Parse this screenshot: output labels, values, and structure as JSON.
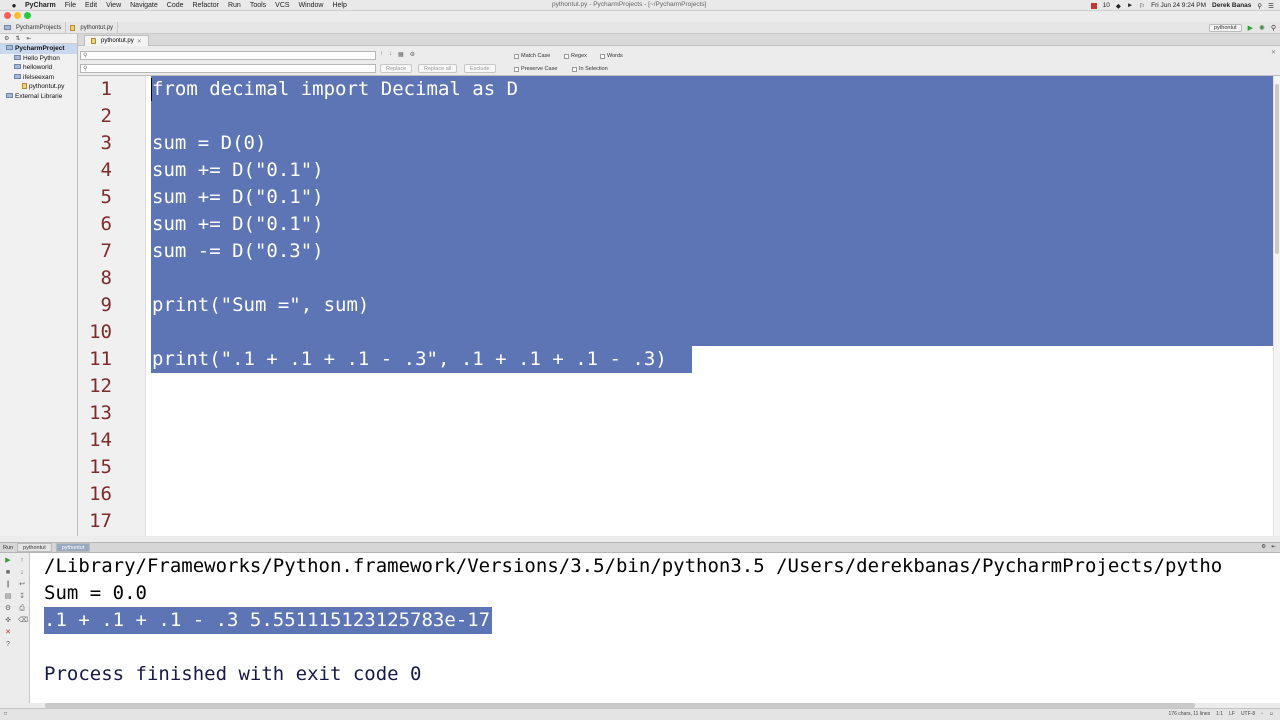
{
  "menubar": {
    "app": "PyCharm",
    "items": [
      "File",
      "Edit",
      "View",
      "Navigate",
      "Code",
      "Refactor",
      "Run",
      "Tools",
      "VCS",
      "Window",
      "Help"
    ],
    "window_title": "pythontut.py - PycharmProjects - [~/PycharmProjects]",
    "battery": "10",
    "datetime": "Fri Jun 24  9:24 PM",
    "user": "Derek Banas"
  },
  "navbar": {
    "crumbs": [
      "PycharmProjects",
      "pythontut.py"
    ],
    "run_config": "pythontut"
  },
  "project": {
    "root": "PycharmProject",
    "items": [
      "Hello Python",
      "helloworld",
      "ifelseexam",
      "pythontut.py"
    ],
    "libraries": "External Librarie"
  },
  "editor": {
    "tab": "pythontut.py",
    "lines": [
      "from decimal import Decimal as D",
      "",
      "sum = D(0)",
      "sum += D(\"0.1\")",
      "sum += D(\"0.1\")",
      "sum += D(\"0.1\")",
      "sum -= D(\"0.3\")",
      "",
      "print(\"Sum =\", sum)",
      "",
      "print(\".1 + .1 + .1 - .3\", .1 + .1 + .1 - .3)",
      "",
      "",
      "",
      "",
      "",
      ""
    ],
    "line_numbers": [
      "1",
      "2",
      "3",
      "4",
      "5",
      "6",
      "7",
      "8",
      "9",
      "10",
      "11",
      "12",
      "13",
      "14",
      "15",
      "16",
      "17"
    ]
  },
  "findbar": {
    "replace_label": "Replace",
    "replace_all_label": "Replace all",
    "exclude_label": "Exclude",
    "match_case": "Match Case",
    "regex": "Regex",
    "words": "Words",
    "preserve_case": "Preserve Case",
    "in_selection": "In Selection"
  },
  "run_panel": {
    "label": "Run",
    "tabs": [
      "pythontut",
      "pythontut"
    ],
    "output": [
      "/Library/Frameworks/Python.framework/Versions/3.5/bin/python3.5 /Users/derekbanas/PycharmProjects/pytho",
      "Sum = 0.0",
      ".1 + .1 + .1 - .3 5.551115123125783e-17",
      "",
      "Process finished with exit code 0"
    ]
  },
  "statusbar": {
    "chars": "176 chars, 11 lines",
    "position": "1:1",
    "line_ending": "LF",
    "encoding": "UTF-8"
  },
  "colors": {
    "selection": "#5d75b5",
    "line_number": "#7d2a2a",
    "console_info": "#17184a"
  }
}
